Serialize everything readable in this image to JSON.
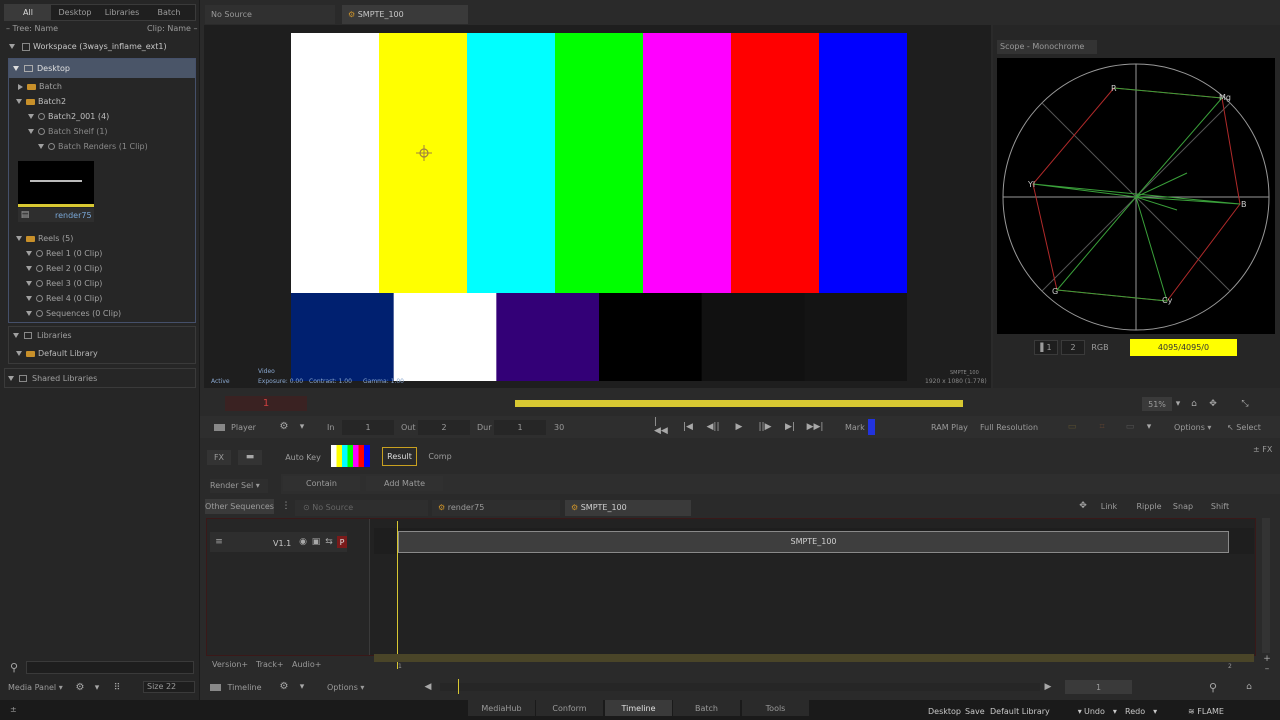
{
  "top_tabs": {
    "all": "All",
    "desktop": "Desktop",
    "libraries": "Libraries",
    "batch": "Batch"
  },
  "tree_header": {
    "tree_label": "Tree: Name",
    "clip_label": "Clip: Name"
  },
  "tree": {
    "workspace": "Workspace (3ways_inflame_ext1)",
    "desktop": "Desktop",
    "batch": "Batch",
    "batch2": "Batch2",
    "batch2_001": "Batch2_001 (4)",
    "batch_shelf": "Batch Shelf (1)",
    "batch_renders": "Batch Renders (1 Clip)",
    "thumb_caption": "render75",
    "reels": "Reels (5)",
    "reel1": "Reel 1 (0 Clip)",
    "reel2": "Reel 2 (0 Clip)",
    "reel3": "Reel 3 (0 Clip)",
    "reel4": "Reel 4 (0 Clip)",
    "sequences": "Sequences (0 Clip)",
    "libraries": "Libraries",
    "default_library": "Default Library",
    "shared_libraries": "Shared Libraries"
  },
  "viewer_tabs": {
    "no_source": "No Source",
    "smpte": "SMPTE_100"
  },
  "viewer": {
    "active": "Active",
    "video": "Video",
    "exposure": "Exposure: 0.00",
    "contrast": "Contrast: 1.00",
    "gamma": "Gamma: 1.00",
    "clip_name": "SMPTE_100",
    "resolution": "1920 x 1080 (1.778)"
  },
  "bars": {
    "top": [
      "#ffffff",
      "#ffff00",
      "#00ffff",
      "#00ff00",
      "#ff00ff",
      "#ff0000",
      "#0000ff"
    ],
    "bottom": [
      "#002070",
      "#ffffff",
      "#330077",
      "#000000",
      "#111111",
      "#141414"
    ]
  },
  "scope": {
    "title": "Scope - Monochrome",
    "labels": {
      "r": "R",
      "mg": "Mg",
      "yl": "Yl",
      "b": "B",
      "g": "G",
      "cy": "Cy"
    },
    "field1": "1",
    "field2": "2",
    "mode": "RGB",
    "value": "4095/4095/0"
  },
  "frame": {
    "current": "1",
    "zoom": "51%"
  },
  "transport": {
    "player": "Player",
    "in_label": "In",
    "in_value": "1",
    "out_label": "Out",
    "out_value": "2",
    "dur_label": "Dur",
    "dur_value": "1",
    "fps": "30",
    "mark": "Mark",
    "ram_play": "RAM Play",
    "full_res": "Full Resolution",
    "options": "Options",
    "select": "Select"
  },
  "fx_row": {
    "fx": "FX",
    "auto_key": "Auto Key",
    "result": "Result",
    "comp": "Comp",
    "fx_right": "FX"
  },
  "render_row": {
    "render_sel": "Render Sel",
    "contain": "Contain",
    "add_matte": "Add Matte"
  },
  "seq_row": {
    "other_sequences": "Other Sequences",
    "no_source": "No Source",
    "render75": "render75",
    "smpte": "SMPTE_100",
    "link": "Link",
    "ripple": "Ripple",
    "snap": "Snap",
    "shift": "Shift"
  },
  "timeline": {
    "track": "V1.1",
    "p_badge": "P",
    "clip": "SMPTE_100",
    "ruler_start": "1",
    "ruler_end": "2",
    "version": "Version+",
    "track_plus": "Track+",
    "audio": "Audio+"
  },
  "bottom_left": {
    "media_panel": "Media Panel",
    "size": "Size 22"
  },
  "bottom_bar": {
    "timeline": "Timeline",
    "options": "Options",
    "frame": "1"
  },
  "status": {
    "left": "±",
    "tabs": [
      "MediaHub",
      "Conform",
      "Timeline",
      "Batch",
      "Tools"
    ],
    "desktop": "Desktop",
    "save": "Save",
    "library": "Default Library",
    "undo": "Undo",
    "redo": "Redo",
    "flame": "FLAME"
  },
  "colors": {
    "accent_yellow": "#ffff00",
    "marker_yellow": "#d8c832",
    "bg": "#2a2a2a"
  }
}
